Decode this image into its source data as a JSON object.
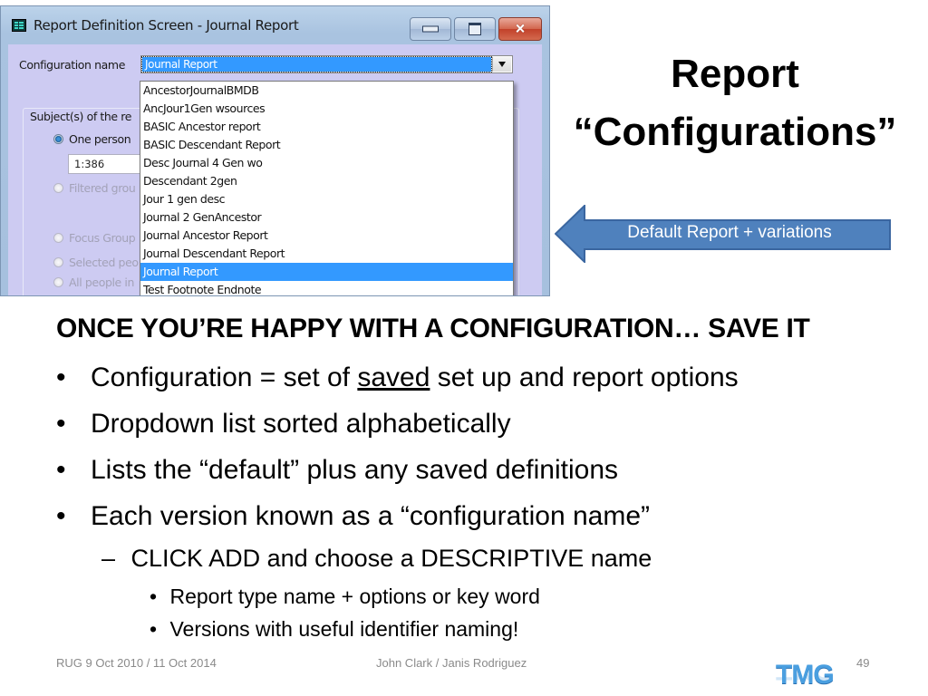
{
  "window": {
    "title": "Report Definition Screen - Journal Report",
    "buttons": {
      "minimize": "minimize",
      "maximize": "maximize",
      "close": "×"
    },
    "configuration_label": "Configuration name",
    "configuration_value": "Journal Report",
    "subjects_label": "Subject(s) of the re",
    "radios": [
      {
        "label": "One person",
        "checked": true,
        "enabled": true
      },
      {
        "label": "Filtered grou",
        "checked": false,
        "enabled": false
      },
      {
        "label": "Focus Group",
        "checked": false,
        "enabled": false
      },
      {
        "label": "Selected peo",
        "checked": false,
        "enabled": false
      },
      {
        "label": "All people in",
        "checked": false,
        "enabled": false
      }
    ],
    "person_id": "1:386",
    "dropdown_items": [
      "AncestorJournalBMDB",
      "AncJour1Gen wsources",
      "BASIC Ancestor report",
      "BASIC Descendant Report",
      "Desc Journal 4 Gen wo",
      "Descendant 2gen",
      "Jour 1 gen desc",
      "Journal 2 GenAncestor",
      "Journal Ancestor Report",
      "Journal Descendant Report",
      "Journal Report",
      "Test Footnote Endnote"
    ],
    "dropdown_selected": "Journal Report"
  },
  "slide": {
    "title_line1": "Report",
    "title_line2": "“Configurations”",
    "callout": "Default Report + variations",
    "headline": "ONCE YOU’RE HAPPY WITH A CONFIGURATION… SAVE IT",
    "bullets": [
      {
        "pre": "Configuration = set of ",
        "underlined": "saved",
        "post": " set up and report options"
      },
      {
        "text": "Dropdown list sorted alphabetically"
      },
      {
        "text": "Lists the “default” plus any saved definitions"
      },
      {
        "text": "Each version known as a “configuration name”"
      }
    ],
    "sub_bullet": "CLICK ADD and choose a DESCRIPTIVE name",
    "sub_sub_bullets": [
      "Report type name + options or key word",
      "Versions with useful identifier naming!"
    ],
    "bullet_glyph": "•",
    "dash_glyph": "–"
  },
  "footer": {
    "left": "RUG 9 Oct 2010 / 11 Oct 2014",
    "center": "John Clark / Janis Rodriguez",
    "logo": "TMG",
    "page": "49"
  },
  "colors": {
    "arrow_fill": "#4f81bd",
    "arrow_stroke": "#3a66a0",
    "selection": "#3399ff",
    "window_client": "#cdcbf2"
  }
}
